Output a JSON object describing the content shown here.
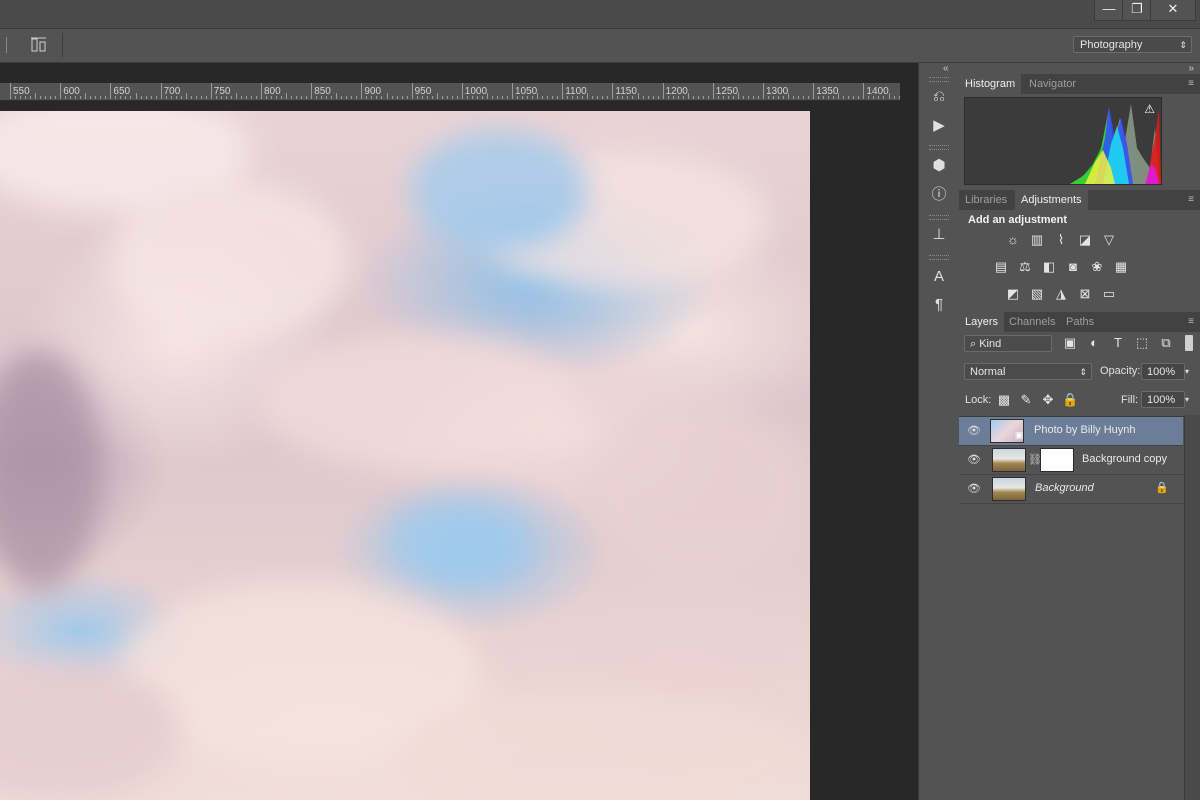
{
  "window": {
    "minimize": "—",
    "restore": "❐",
    "close": "✕"
  },
  "options_bar": {
    "workspace": "Photography",
    "workspace_arrow": "⇕"
  },
  "ruler": {
    "labels": [
      "550",
      "600",
      "650",
      "700",
      "750",
      "800",
      "850",
      "900",
      "950",
      "1000",
      "1050",
      "1100",
      "1150",
      "1200",
      "1250",
      "1300",
      "1350",
      "1400"
    ]
  },
  "icon_strip": {
    "collapse": "«",
    "icons": [
      "history-icon",
      "play-actions-icon",
      "3d-cube-icon",
      "info-icon",
      "clone-source-icon",
      "character-icon",
      "paragraph-icon"
    ]
  },
  "histogram_panel": {
    "tabs": [
      "Histogram",
      "Navigator"
    ],
    "active_tab": "Histogram",
    "warning": "⚠"
  },
  "adjustments_panel": {
    "tabs": [
      "Libraries",
      "Adjustments"
    ],
    "active_tab": "Adjustments",
    "heading": "Add an adjustment",
    "rows": [
      [
        "brightness-contrast-icon",
        "levels-icon",
        "curves-icon",
        "exposure-icon",
        "vibrance-icon"
      ],
      [
        "hue-saturation-icon",
        "color-balance-icon",
        "black-white-icon",
        "photo-filter-icon",
        "channel-mixer-icon",
        "color-lookup-icon"
      ],
      [
        "invert-icon",
        "posterize-icon",
        "threshold-icon",
        "selective-color-icon",
        "gradient-map-icon"
      ]
    ]
  },
  "layers_panel": {
    "tabs": [
      "Layers",
      "Channels",
      "Paths"
    ],
    "active_tab": "Layers",
    "filter_kind": "Kind",
    "blend_mode": "Normal",
    "opacity_label": "Opacity:",
    "opacity_value": "100%",
    "lock_label": "Lock:",
    "fill_label": "Fill:",
    "fill_value": "100%",
    "layers": [
      {
        "name": "Photo by Billy Huynh",
        "selected": true,
        "locked": false,
        "has_mask": false
      },
      {
        "name": "Background copy",
        "selected": false,
        "locked": false,
        "has_mask": true
      },
      {
        "name": "Background",
        "selected": false,
        "locked": true,
        "has_mask": false
      }
    ]
  }
}
